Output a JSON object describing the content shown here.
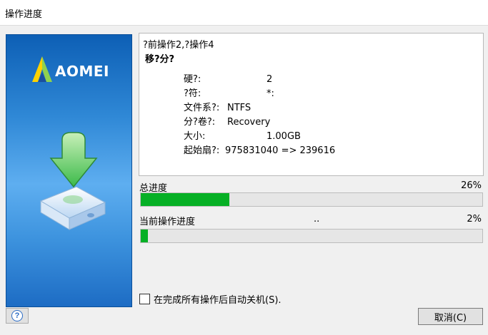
{
  "window": {
    "title": "操作进度"
  },
  "banner": {
    "brand": "AOMEI"
  },
  "info": {
    "header": "?前操作2,?操作4",
    "subheader": "移?分?",
    "rows": [
      {
        "key": "硬?:",
        "value": "2"
      },
      {
        "key": "?符:",
        "value": "*:"
      },
      {
        "key": "文件系?:",
        "value": "NTFS"
      },
      {
        "key": "分?卷?:",
        "value": "Recovery"
      },
      {
        "key": "大小:",
        "value": "1.00GB"
      },
      {
        "key": "起始扇?:",
        "value": "975831040 => 239616"
      }
    ]
  },
  "progress": {
    "total_label": "总进度",
    "total_percent_text": "26%",
    "total_fraction": 0.26,
    "current_label": "当前操作进度",
    "current_status": "..",
    "current_percent_text": "2%",
    "current_fraction": 0.02
  },
  "options": {
    "shutdown_label": "在完成所有操作后自动关机(S).",
    "shutdown_checked": false
  },
  "buttons": {
    "help_glyph": "?",
    "cancel_label": "取消(C)"
  },
  "colors": {
    "progress_fill": "#06b025",
    "banner_blue": "#2f88d6"
  }
}
